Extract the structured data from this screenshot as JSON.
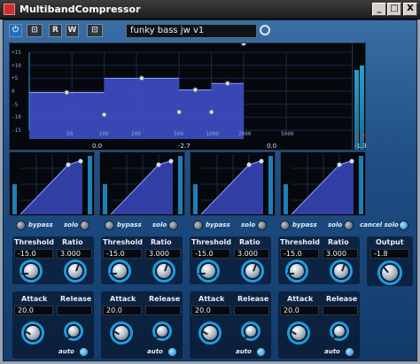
{
  "window": {
    "title": "MultibandCompressor",
    "minimize": "_",
    "maximize": "□",
    "close": "X"
  },
  "toolbar": {
    "power_label": "⏻",
    "bypass_label": "⊡",
    "read_label": "R",
    "write_label": "W",
    "settings_label": "⊡",
    "preset_name": "funky bass jw v1"
  },
  "display": {
    "y_ticks": [
      "+15",
      "+10",
      "+5",
      "0",
      "-5",
      "-10",
      "-15"
    ],
    "x_ticks": [
      "50",
      "100",
      "200",
      "500",
      "1000",
      "2000",
      "5000"
    ],
    "band_gains_db": [
      -0.5,
      5.0,
      0.5,
      3.0
    ],
    "crossover_hz": [
      100,
      500,
      1000,
      2000
    ]
  },
  "meters": {
    "band_gr_readouts": [
      "0.0",
      "-2.7",
      "0.0",
      "-1.3"
    ],
    "output_peak": "0.7"
  },
  "bands": [
    {
      "bypass_label": "bypass",
      "solo_label": "solo",
      "threshold_label": "Threshold",
      "threshold_value": "-15.0",
      "ratio_label": "Ratio",
      "ratio_value": "3.000",
      "attack_label": "Attack",
      "attack_value": "20.0",
      "release_label": "Release",
      "release_value": "",
      "auto_label": "auto"
    },
    {
      "bypass_label": "bypass",
      "solo_label": "solo",
      "threshold_label": "Threshold",
      "threshold_value": "-15.0",
      "ratio_label": "Ratio",
      "ratio_value": "3.000",
      "attack_label": "Attack",
      "attack_value": "20.0",
      "release_label": "Release",
      "release_value": "",
      "auto_label": "auto"
    },
    {
      "bypass_label": "bypass",
      "solo_label": "solo",
      "threshold_label": "Threshold",
      "threshold_value": "-15.0",
      "ratio_label": "Ratio",
      "ratio_value": "3.000",
      "attack_label": "Attack",
      "attack_value": "20.0",
      "release_label": "Release",
      "release_value": "",
      "auto_label": "auto"
    },
    {
      "bypass_label": "bypass",
      "solo_label": "solo",
      "threshold_label": "Threshold",
      "threshold_value": "-15.0",
      "ratio_label": "Ratio",
      "ratio_value": "3.000",
      "attack_label": "Attack",
      "attack_value": "20.0",
      "release_label": "Release",
      "release_value": "",
      "auto_label": "auto"
    }
  ],
  "cancel_solo_label": "cancel solo",
  "output": {
    "label": "Output",
    "value": "-1.8"
  },
  "colors": {
    "accent": "#1e9be0",
    "band_fill": "#3f4fc8",
    "meter_red": "#ff3b3b"
  }
}
